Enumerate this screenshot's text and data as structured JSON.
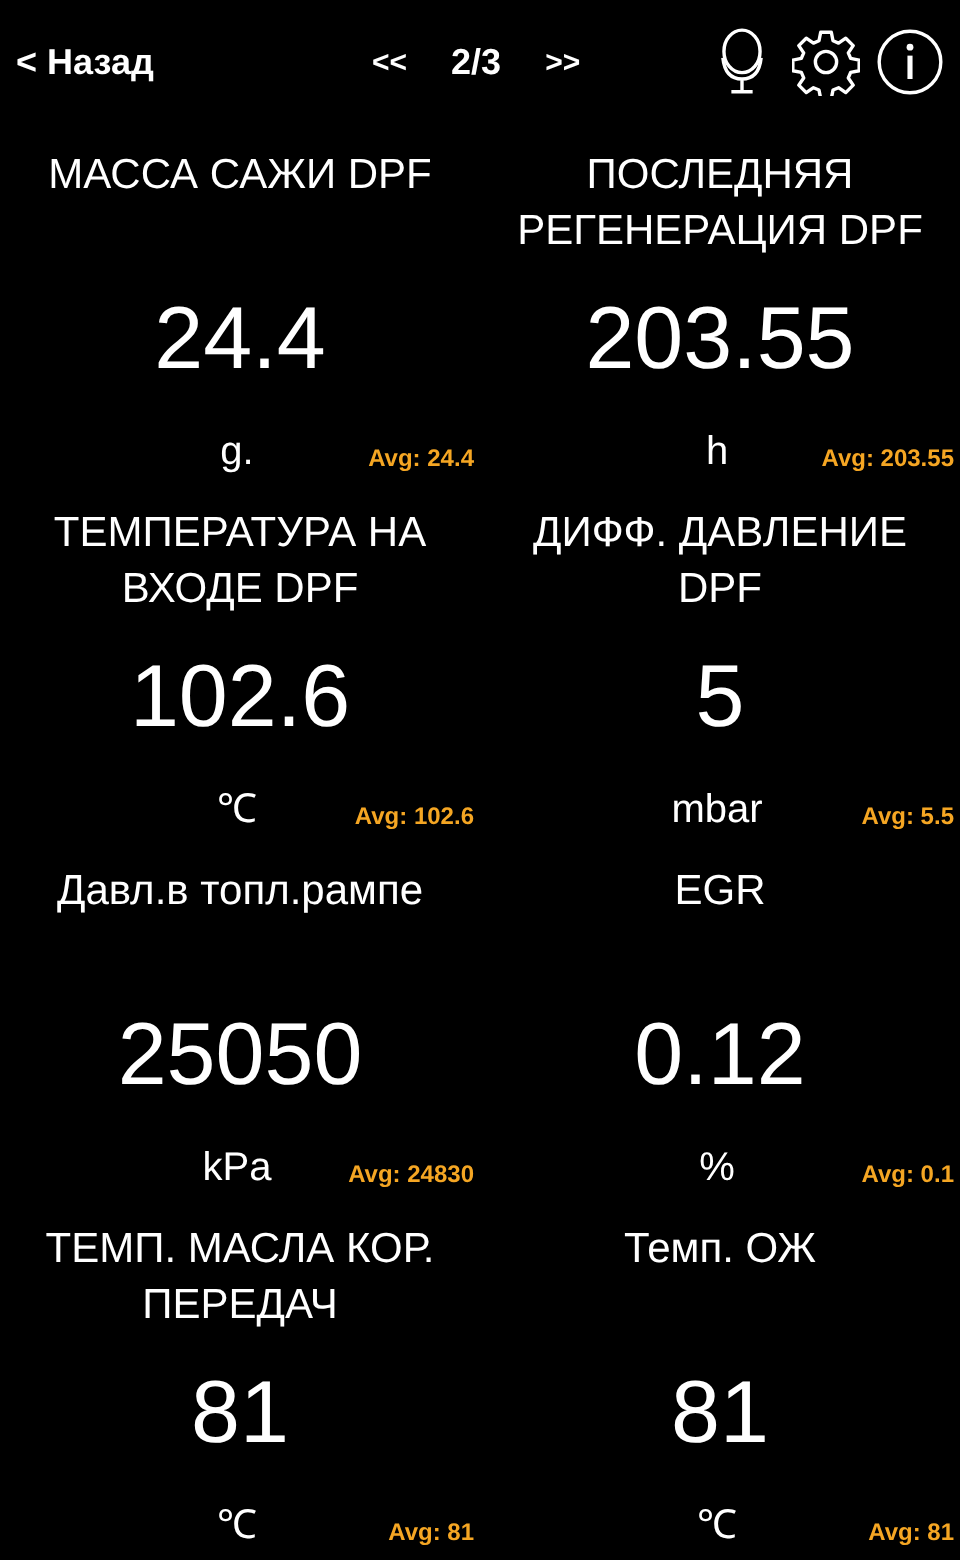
{
  "header": {
    "back": "< Назад",
    "prev": "<<",
    "page": "2/3",
    "next": ">>"
  },
  "gauges": [
    {
      "title": "МАССА САЖИ  DPF",
      "value": "24.4",
      "unit": "g.",
      "avg": "Avg: 24.4"
    },
    {
      "title": "ПОСЛЕДНЯЯ РЕГЕНЕРАЦИЯ DPF",
      "value": "203.55",
      "unit": "h",
      "avg": "Avg: 203.55"
    },
    {
      "title": "ТЕМПЕРАТУРА НА ВХОДЕ DPF",
      "value": "102.6",
      "unit": "℃",
      "avg": "Avg: 102.6"
    },
    {
      "title": "ДИФФ. ДАВЛЕНИЕ DPF",
      "value": "5",
      "unit": "mbar",
      "avg": "Avg: 5.5"
    },
    {
      "title": "Давл.в топл.рампе",
      "value": "25050",
      "unit": "kPa",
      "avg": "Avg: 24830"
    },
    {
      "title": "EGR",
      "value": "0.12",
      "unit": "%",
      "avg": "Avg: 0.1"
    },
    {
      "title": "ТЕМП. МАСЛА КОР. ПЕРЕДАЧ",
      "value": "81",
      "unit": "℃",
      "avg": "Avg: 81"
    },
    {
      "title": "Темп. ОЖ",
      "value": "81",
      "unit": "℃",
      "avg": "Avg: 81"
    }
  ]
}
